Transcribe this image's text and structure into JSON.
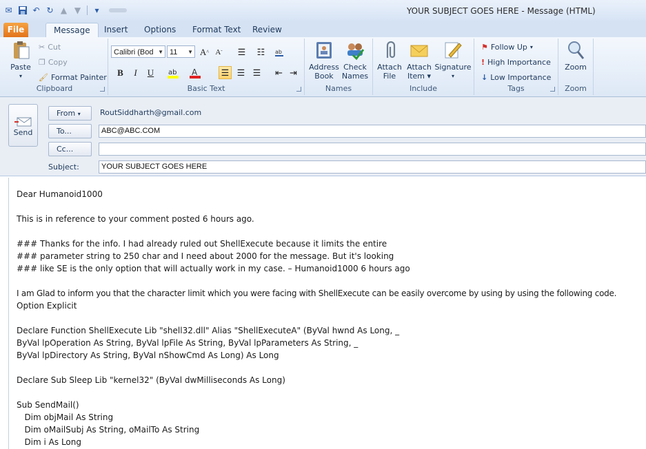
{
  "window": {
    "title": "YOUR SUBJECT GOES HERE  -  Message (HTML)"
  },
  "tabs": [
    "File",
    "Message",
    "Insert",
    "Options",
    "Format Text",
    "Review"
  ],
  "ribbon": {
    "clipboard": {
      "paste": "Paste",
      "cut": "Cut",
      "copy": "Copy",
      "format_painter": "Format Painter",
      "label": "Clipboard"
    },
    "basic_text": {
      "font": "Calibri (Bod",
      "size": "11",
      "label": "Basic Text"
    },
    "names": {
      "address_book": [
        "Address",
        "Book"
      ],
      "check_names": [
        "Check",
        "Names"
      ],
      "label": "Names"
    },
    "include": {
      "attach_file": [
        "Attach",
        "File"
      ],
      "attach_item": [
        "Attach",
        "Item"
      ],
      "signature": "Signature",
      "label": "Include"
    },
    "tags": {
      "follow_up": "Follow Up",
      "high": "High Importance",
      "low": "Low Importance",
      "label": "Tags"
    },
    "zoom": {
      "button": "Zoom",
      "label": "Zoom"
    }
  },
  "header": {
    "send": "Send",
    "from_label": "From",
    "from_value": "RoutSiddharth@gmail.com",
    "to_label": "To...",
    "to_value": "ABC@ABC.COM",
    "cc_label": "Cc...",
    "cc_value": "",
    "subject_label": "Subject:",
    "subject_value": "YOUR SUBJECT GOES HERE"
  },
  "body_lines": [
    "Dear Humanoid1000",
    "This is in reference to your comment posted 6 hours ago.",
    "### Thanks for the info. I had already ruled out ShellExecute because it limits the entire",
    "### parameter string to 250 char and I need about 2000 for the message. But it's looking",
    "### like SE is the only option that will actually work in my case. – Humanoid1000 6 hours ago",
    "I am Glad to inform you that the character limit which you were facing with ShellExecute can be easily overcome by using by using the following code.",
    "Option Explicit",
    "Declare Function ShellExecute Lib \"shell32.dll\" Alias \"ShellExecuteA\" (ByVal hwnd As Long, _",
    "ByVal lpOperation As String, ByVal lpFile As String, ByVal lpParameters As String, _",
    "ByVal lpDirectory As String, ByVal nShowCmd As Long) As Long",
    "Declare Sub Sleep Lib \"kernel32\" (ByVal dwMilliseconds As Long)",
    "Sub SendMail()",
    "   Dim objMail As String",
    "   Dim oMailSubj As String, oMailTo As String",
    "   Dim i As Long"
  ]
}
